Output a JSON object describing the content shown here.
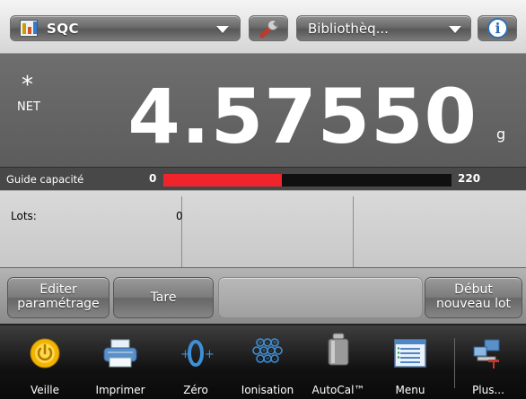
{
  "header": {
    "application": "SQC",
    "library": "Bibliothèq...",
    "icons": [
      "bar-chart-icon",
      "wrench-icon",
      "info-icon"
    ]
  },
  "display": {
    "stable_indicator": "*",
    "mode": "NET",
    "weight": "4.57550",
    "unit": "g"
  },
  "capacity": {
    "label": "Guide capacité",
    "min": "0",
    "max": "220",
    "fill_fraction": 0.41
  },
  "data_fields": {
    "lots_label": "Lots:",
    "lots_value": "0"
  },
  "soft_keys": {
    "edit_line1": "Editer",
    "edit_line2": "paramétrage",
    "tare": "Tare",
    "new_lot_line1": "Début",
    "new_lot_line2": "nouveau lot"
  },
  "toolbar": {
    "items": [
      {
        "label": "Veille",
        "icon": "power-icon"
      },
      {
        "label": "Imprimer",
        "icon": "printer-icon"
      },
      {
        "label": "Zéro",
        "icon": "zero-icon"
      },
      {
        "label": "Ionisation",
        "icon": "ionizer-icon"
      },
      {
        "label": "AutoCal™",
        "icon": "calibration-weight-icon"
      },
      {
        "label": "Menu",
        "icon": "menu-icon"
      },
      {
        "label": "Plus...",
        "icon": "more-icon"
      }
    ]
  },
  "colors": {
    "capacity_fill": "#f0242b",
    "accent_blue": "#2f6fb5",
    "power_yellow": "#f2b400"
  }
}
